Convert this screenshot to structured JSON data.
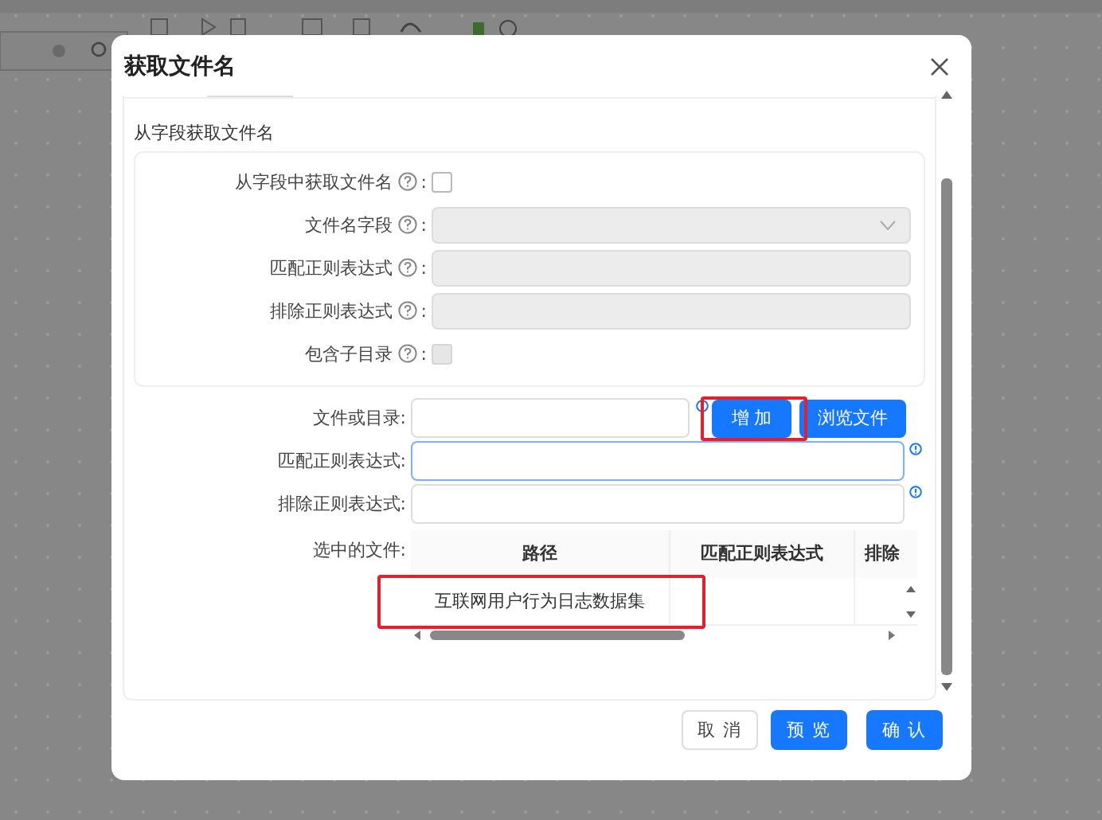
{
  "window": {
    "title": "获取文件名"
  },
  "field_section": {
    "title": "从字段获取文件名",
    "rows": [
      {
        "kind": "checkbox",
        "label": "从字段中获取文件名",
        "suffix": ":",
        "checked": false,
        "disabled": false
      },
      {
        "kind": "select",
        "label": "文件名字段",
        "suffix": ":",
        "disabled": true
      },
      {
        "kind": "text",
        "label": "匹配正则表达式",
        "suffix": ":",
        "disabled": true
      },
      {
        "kind": "text",
        "label": "排除正则表达式",
        "suffix": ":",
        "disabled": true
      },
      {
        "kind": "checkbox",
        "label": "包含子目录",
        "suffix": ":",
        "checked": false,
        "disabled": true
      }
    ]
  },
  "file_form": {
    "file_label": "文件或目录:",
    "add_button": {
      "label": "增 加",
      "highlighted": true
    },
    "browse_button": "浏览文件",
    "regex_fields": [
      {
        "label": "匹配正则表达式:",
        "focused": true
      },
      {
        "label": "排除正则表达式:",
        "focused": false
      }
    ],
    "selected_label": "选中的文件:",
    "table": {
      "columns": [
        "路径",
        "匹配正则表达式",
        "排除"
      ],
      "rows": [
        {
          "path": "互联网用户行为日志数据集",
          "highlighted": true
        }
      ]
    }
  },
  "buttons": [
    {
      "label": "取 消",
      "kind": "default"
    },
    {
      "label": "预 览",
      "kind": "primary"
    },
    {
      "label": "确 认",
      "kind": "primary"
    }
  ]
}
